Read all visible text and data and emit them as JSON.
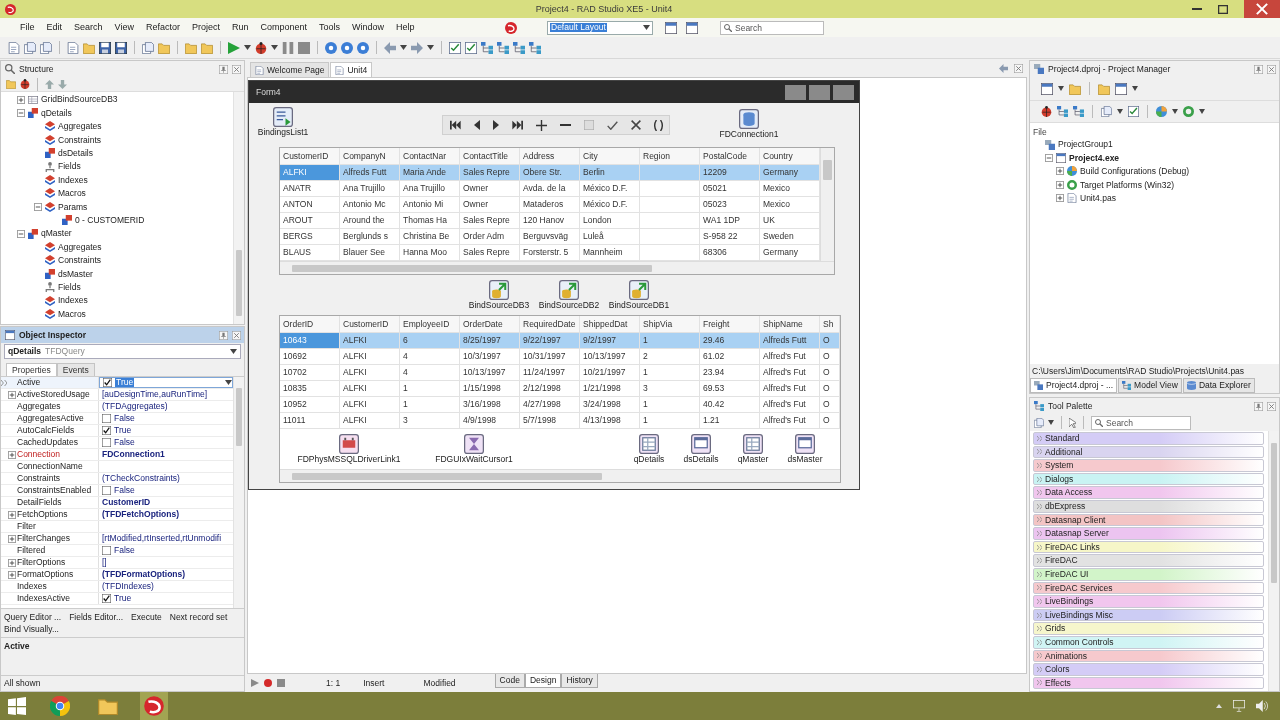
{
  "window": {
    "title": "Project4 - RAD Studio XE5 - Unit4"
  },
  "menu": [
    "File",
    "Edit",
    "Search",
    "View",
    "Refactor",
    "Project",
    "Run",
    "Component",
    "Tools",
    "Window",
    "Help"
  ],
  "layout_combo": {
    "value": "Default Layout"
  },
  "search": {
    "placeholder": "Search"
  },
  "structure": {
    "title": "Structure",
    "tree": [
      {
        "label": "GridBindSourceDB3",
        "kind": "grid",
        "expanded": false
      },
      {
        "label": "qDetails",
        "kind": "component",
        "expanded": true,
        "children": [
          {
            "label": "Aggregates",
            "kind": "collection"
          },
          {
            "label": "Constraints",
            "kind": "collection"
          },
          {
            "label": "dsDetails",
            "kind": "component"
          },
          {
            "label": "Fields",
            "kind": "fields"
          },
          {
            "label": "Indexes",
            "kind": "collection"
          },
          {
            "label": "Macros",
            "kind": "collection"
          },
          {
            "label": "Params",
            "kind": "collection",
            "expanded": true,
            "children": [
              {
                "label": "0 - CUSTOMERID",
                "kind": "component"
              }
            ]
          }
        ]
      },
      {
        "label": "qMaster",
        "kind": "component",
        "expanded": true,
        "children": [
          {
            "label": "Aggregates",
            "kind": "collection"
          },
          {
            "label": "Constraints",
            "kind": "collection"
          },
          {
            "label": "dsMaster",
            "kind": "component"
          },
          {
            "label": "Fields",
            "kind": "fields"
          },
          {
            "label": "Indexes",
            "kind": "collection"
          },
          {
            "label": "Macros",
            "kind": "collection"
          }
        ]
      }
    ]
  },
  "object_inspector": {
    "title": "Object Inspector",
    "component": {
      "name": "qDetails",
      "type": "TFDQuery"
    },
    "tabs": [
      {
        "label": "Properties",
        "selected": true
      },
      {
        "label": "Events",
        "selected": false
      }
    ],
    "properties": [
      {
        "name": "Active",
        "value": "True",
        "kind": "check",
        "checked": true,
        "modified": false,
        "reference": false,
        "selected": true
      },
      {
        "name": "ActiveStoredUsage",
        "value": "[auDesignTime,auRunTime]",
        "kind": "text",
        "expanded": false,
        "modified": false,
        "reference": false,
        "selected": false
      },
      {
        "name": "Aggregates",
        "value": "(TFDAggregates)",
        "kind": "text",
        "modified": false,
        "reference": false,
        "selected": false
      },
      {
        "name": "AggregatesActive",
        "value": "False",
        "kind": "check",
        "checked": false,
        "modified": false,
        "reference": false,
        "selected": false
      },
      {
        "name": "AutoCalcFields",
        "value": "True",
        "kind": "check",
        "checked": true,
        "modified": false,
        "reference": false,
        "selected": false
      },
      {
        "name": "CachedUpdates",
        "value": "False",
        "kind": "check",
        "checked": false,
        "modified": false,
        "reference": false,
        "selected": false
      },
      {
        "name": "Connection",
        "value": "FDConnection1",
        "kind": "text",
        "expanded": false,
        "modified": true,
        "reference": true,
        "selected": false
      },
      {
        "name": "ConnectionName",
        "kind": "text",
        "reference": false,
        "selected": false
      },
      {
        "name": "Constraints",
        "value": "(TCheckConstraints)",
        "kind": "text",
        "modified": false,
        "reference": false,
        "selected": false
      },
      {
        "name": "ConstraintsEnabled",
        "value": "False",
        "kind": "check",
        "checked": false,
        "modified": false,
        "reference": false,
        "selected": false
      },
      {
        "name": "DetailFields",
        "value": "CustomerID",
        "kind": "text",
        "modified": true,
        "reference": false,
        "selected": false
      },
      {
        "name": "FetchOptions",
        "value": "(TFDFetchOptions)",
        "kind": "text",
        "expanded": false,
        "modified": true,
        "reference": false,
        "selected": false
      },
      {
        "name": "Filter",
        "kind": "text",
        "reference": false,
        "selected": false
      },
      {
        "name": "FilterChanges",
        "value": "[rtModified,rtInserted,rtUnmodifi",
        "kind": "text",
        "expanded": false,
        "modified": false,
        "reference": false,
        "selected": false
      },
      {
        "name": "Filtered",
        "value": "False",
        "kind": "check",
        "checked": false,
        "modified": false,
        "reference": false,
        "selected": false
      },
      {
        "name": "FilterOptions",
        "value": "[]",
        "kind": "text",
        "expanded": false,
        "modified": false,
        "reference": false,
        "selected": false
      },
      {
        "name": "FormatOptions",
        "value": "(TFDFormatOptions)",
        "kind": "text",
        "expanded": false,
        "modified": true,
        "reference": false,
        "selected": false
      },
      {
        "name": "Indexes",
        "value": "(TFDIndexes)",
        "kind": "text",
        "modified": false,
        "reference": false,
        "selected": false
      },
      {
        "name": "IndexesActive",
        "value": "True",
        "kind": "check",
        "checked": true,
        "modified": false,
        "reference": false,
        "selected": false
      }
    ],
    "links": [
      "Query Editor ...",
      "Fields Editor...",
      "Execute",
      "Next record set",
      "Bind Visually..."
    ],
    "description": "Active",
    "status": "All shown"
  },
  "editor_tabs": [
    {
      "label": "Welcome Page",
      "selected": false
    },
    {
      "label": "Unit4",
      "selected": true
    }
  ],
  "form": {
    "title": "Form4",
    "components": [
      {
        "label": "BindingsList1",
        "kind": "bindings"
      },
      {
        "label": "FDConnection1",
        "kind": "connection"
      },
      {
        "label": "BindSourceDB3",
        "kind": "bindsource"
      },
      {
        "label": "BindSourceDB2",
        "kind": "bindsource"
      },
      {
        "label": "BindSourceDB1",
        "kind": "bindsource"
      },
      {
        "label": "FDPhysMSSQLDriverLink1",
        "kind": "driverlink"
      },
      {
        "label": "FDGUIxWaitCursor1",
        "kind": "waitcursor"
      },
      {
        "label": "qDetails",
        "kind": "query"
      },
      {
        "label": "dsDetails",
        "kind": "datasource"
      },
      {
        "label": "qMaster",
        "kind": "query"
      },
      {
        "label": "dsMaster",
        "kind": "datasource"
      }
    ],
    "customers_grid": {
      "columns": [
        "CustomerID",
        "CompanyN",
        "ContactNar",
        "ContactTitle",
        "Address",
        "City",
        "Region",
        "PostalCode",
        "Country"
      ],
      "rows": [
        {
          "selected": true,
          "cells": [
            "ALFKI",
            "Alfreds Futt",
            "Maria Ande",
            "Sales Repre",
            "Obere Str.",
            "Berlin",
            null,
            "12209",
            "Germany"
          ]
        },
        {
          "selected": false,
          "cells": [
            "ANATR",
            "Ana Trujillo",
            "Ana Trujillo",
            "Owner",
            "Avda. de la",
            "México D.F.",
            null,
            "05021",
            "Mexico"
          ]
        },
        {
          "selected": false,
          "cells": [
            "ANTON",
            "Antonio Mc",
            "Antonio Mi",
            "Owner",
            "Mataderos",
            "México D.F.",
            null,
            "05023",
            "Mexico"
          ]
        },
        {
          "selected": false,
          "cells": [
            "AROUT",
            "Around the",
            "Thomas Ha",
            "Sales Repre",
            "120 Hanov",
            "London",
            null,
            "WA1 1DP",
            "UK"
          ]
        },
        {
          "selected": false,
          "cells": [
            "BERGS",
            "Berglunds s",
            "Christina Be",
            "Order Adm",
            "Berguvsväg",
            "Luleå",
            null,
            "S-958 22",
            "Sweden"
          ]
        },
        {
          "selected": false,
          "cells": [
            "BLAUS",
            "Blauer See",
            "Hanna Moo",
            "Sales Repre",
            "Forsterstr. 5",
            "Mannheim",
            null,
            "68306",
            "Germany"
          ]
        }
      ]
    },
    "orders_grid": {
      "columns": [
        "OrderID",
        "CustomerID",
        "EmployeeID",
        "OrderDate",
        "RequiredDate",
        "ShippedDat",
        "ShipVia",
        "Freight",
        "ShipName",
        "Sh"
      ],
      "rows": [
        {
          "selected": true,
          "cells": [
            "10643",
            "ALFKI",
            "6",
            "8/25/1997",
            "9/22/1997",
            "9/2/1997",
            "1",
            "29.46",
            "Alfreds Futt",
            "O"
          ]
        },
        {
          "selected": false,
          "cells": [
            "10692",
            "ALFKI",
            "4",
            "10/3/1997",
            "10/31/1997",
            "10/13/1997",
            "2",
            "61.02",
            "Alfred's Fut",
            "O"
          ]
        },
        {
          "selected": false,
          "cells": [
            "10702",
            "ALFKI",
            "4",
            "10/13/1997",
            "11/24/1997",
            "10/21/1997",
            "1",
            "23.94",
            "Alfred's Fut",
            "O"
          ]
        },
        {
          "selected": false,
          "cells": [
            "10835",
            "ALFKI",
            "1",
            "1/15/1998",
            "2/12/1998",
            "1/21/1998",
            "3",
            "69.53",
            "Alfred's Fut",
            "O"
          ]
        },
        {
          "selected": false,
          "cells": [
            "10952",
            "ALFKI",
            "1",
            "3/16/1998",
            "4/27/1998",
            "3/24/1998",
            "1",
            "40.42",
            "Alfred's Fut",
            "O"
          ]
        },
        {
          "selected": false,
          "cells": [
            "11011",
            "ALFKI",
            "3",
            "4/9/1998",
            "5/7/1998",
            "4/13/1998",
            "1",
            "1.21",
            "Alfred's Fut",
            "O"
          ]
        }
      ]
    }
  },
  "editor_status": {
    "position": "1: 1",
    "mode": "Insert",
    "state": "Modified",
    "view_tabs": [
      {
        "label": "Code",
        "selected": false
      },
      {
        "label": "Design",
        "selected": true
      },
      {
        "label": "History",
        "selected": false
      }
    ]
  },
  "project_manager": {
    "title": "Project4.dproj - Project Manager",
    "column": "File",
    "tree": [
      {
        "label": "ProjectGroup1",
        "kind": "group",
        "children": [
          {
            "label": "Project4.exe",
            "kind": "project",
            "expanded": true,
            "children": [
              {
                "label": "Build Configurations (Debug)",
                "kind": "configs",
                "expanded": false
              },
              {
                "label": "Target Platforms (Win32)",
                "kind": "platforms",
                "expanded": false
              },
              {
                "label": "Unit4.pas",
                "kind": "unit",
                "expanded": false
              }
            ]
          }
        ]
      }
    ],
    "path": "C:\\Users\\Jim\\Documents\\RAD Studio\\Projects\\Unit4.pas",
    "tabs": [
      {
        "label": "Project4.dproj - ...",
        "selected": true
      },
      {
        "label": "Model View",
        "selected": false
      },
      {
        "label": "Data Explorer",
        "selected": false
      }
    ]
  },
  "tool_palette": {
    "title": "Tool Palette",
    "search": {
      "placeholder": "Search"
    },
    "categories": [
      {
        "label": "Standard",
        "color": "#d4ccf6"
      },
      {
        "label": "Additional",
        "color": "#d9d4f0"
      },
      {
        "label": "System",
        "color": "#f6c9cd"
      },
      {
        "label": "Dialogs",
        "color": "#c9f3f3"
      },
      {
        "label": "Data Access",
        "color": "#f1c6ee"
      },
      {
        "label": "dbExpress",
        "color": "#dedede"
      },
      {
        "label": "Datasnap Client",
        "color": "#f3c4c4"
      },
      {
        "label": "Datasnap Server",
        "color": "#ecc4f0"
      },
      {
        "label": "FireDAC Links",
        "color": "#f6f6c8"
      },
      {
        "label": "FireDAC",
        "color": "#e2e2e2"
      },
      {
        "label": "FireDAC UI",
        "color": "#d2f4c9"
      },
      {
        "label": "FireDAC Services",
        "color": "#f6c9cd"
      },
      {
        "label": "LiveBindings",
        "color": "#f1c6ee"
      },
      {
        "label": "LiveBindings Misc",
        "color": "#ccccf4"
      },
      {
        "label": "Grids",
        "color": "#f6f6cc"
      },
      {
        "label": "Common Controls",
        "color": "#d0f4f4"
      },
      {
        "label": "Animations",
        "color": "#f6c9cd"
      },
      {
        "label": "Colors",
        "color": "#d4ccf6"
      },
      {
        "label": "Effects",
        "color": "#f1c6ee"
      }
    ]
  }
}
